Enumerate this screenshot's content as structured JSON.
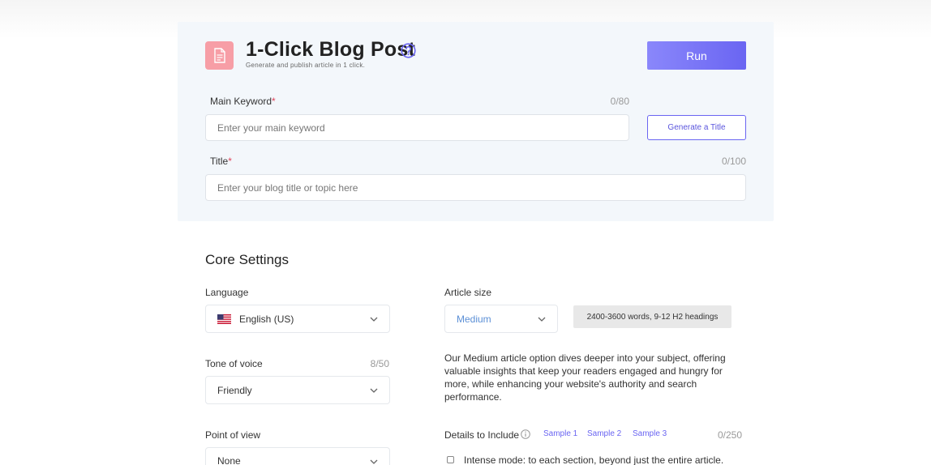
{
  "header": {
    "title": "1-Click Blog Post",
    "subtitle": "Generate and publish article in 1 click.",
    "run_label": "Run",
    "icon": "document-icon"
  },
  "main_keyword": {
    "label": "Main Keyword",
    "required_mark": "*",
    "counter": "0/80",
    "placeholder": "Enter your main keyword",
    "value": "",
    "generate_title_label": "Generate a Title"
  },
  "title_field": {
    "label": "Title",
    "required_mark": "*",
    "counter": "0/100",
    "placeholder": "Enter your blog title or topic here",
    "value": ""
  },
  "core_settings": {
    "heading": "Core Settings",
    "language": {
      "label": "Language",
      "value": "English (US)",
      "icon": "us-flag-icon"
    },
    "article_size": {
      "label": "Article size",
      "value": "Medium",
      "badge": "2400-3600 words, 9-12 H2 headings",
      "description": "Our Medium article option dives deeper into your subject, offering valuable insights that keep your readers engaged and hungry for more, while enhancing your website's authority and search performance."
    },
    "tone": {
      "label": "Tone of voice",
      "counter": "8/50",
      "value": "Friendly"
    },
    "point_of_view": {
      "label": "Point of view",
      "value": "None"
    },
    "details": {
      "label": "Details to Include",
      "samples": [
        "Sample 1",
        "Sample 2",
        "Sample 3"
      ],
      "counter": "0/250",
      "intense_mode_label": "Intense mode: to each section, beyond just the entire article.",
      "intense_mode_checked": false
    }
  },
  "colors": {
    "accent": "#6a65f2",
    "required": "#e0445a",
    "app_icon_bg": "#f79ea6",
    "panel_bg": "#f3f7fb"
  }
}
